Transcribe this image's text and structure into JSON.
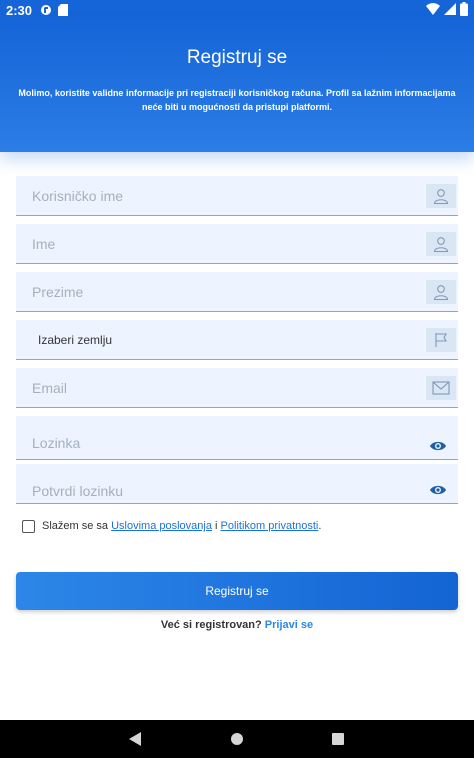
{
  "status_bar": {
    "time": "2:30"
  },
  "header": {
    "title": "Registruj se",
    "subtitle": "Molimo, koristite validne informacije pri registraciji korisničkog računa. Profil sa lažnim informacijama neće biti u mogućnosti da pristupi platformi."
  },
  "form": {
    "username": {
      "placeholder": "Korisničko ime",
      "icon": "user-icon"
    },
    "first_name": {
      "placeholder": "Ime",
      "icon": "user-icon"
    },
    "last_name": {
      "placeholder": "Prezime",
      "icon": "user-icon"
    },
    "country": {
      "label": "Izaberi zemlju",
      "icon": "flag-icon"
    },
    "email": {
      "placeholder": "Email",
      "icon": "envelope-icon"
    },
    "password": {
      "placeholder": "Lozinka",
      "icon": "eye-icon"
    },
    "confirm_password": {
      "placeholder": "Potvrdi lozinku",
      "icon": "eye-icon"
    }
  },
  "terms": {
    "prefix": "Slažem se sa ",
    "terms_link": "Uslovima poslovanja",
    "middle": " i ",
    "privacy_link": "Politikom privatnosti",
    "suffix": "."
  },
  "register_button": "Registruj se",
  "login": {
    "prompt": "Već si registrovan? ",
    "link": "Prijavi se"
  },
  "colors": {
    "primary": "#1565d8",
    "accent": "#2c87e8",
    "field_bg": "#eef4ff",
    "link": "#1a73d9"
  }
}
